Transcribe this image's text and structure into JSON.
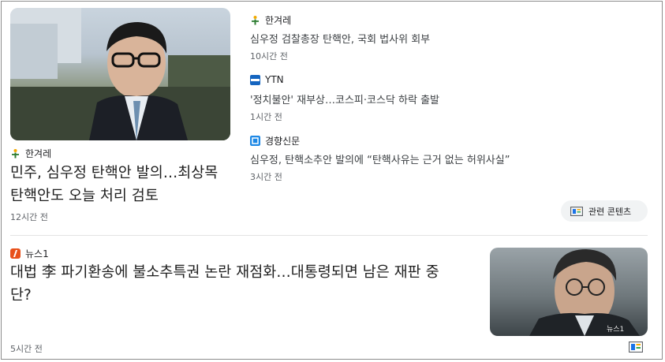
{
  "top_story": {
    "image_alt": "man with glasses in suit",
    "source": "한겨레",
    "headline_line1": "민주, 심우정 탄핵안 발의…최상목",
    "headline_line2": "탄핵안도 오늘 처리 검토",
    "time": "12시간 전"
  },
  "related_items": [
    {
      "source": "한겨레",
      "headline": "심우정 검찰총장 탄핵안, 국회 법사위 회부",
      "time": "10시간 전"
    },
    {
      "source": "YTN",
      "headline": "'정치불안' 재부상…코스피·코스닥 하락 출발",
      "time": "1시간 전"
    },
    {
      "source": "경향신문",
      "headline": "심우정, 탄핵소추안 발의에 “탄핵사유는 근거 없는 허위사실”",
      "time": "3시간 전"
    }
  ],
  "related_button": {
    "label": "관련 콘텐츠"
  },
  "second_story": {
    "source": "뉴스1",
    "headline_line1": "대법 李 파기환송에 불소추특권 논란 재점화…대통령되면 남은 재판 중",
    "headline_line2": "단?",
    "time": "5시간 전",
    "image_watermark": "뉴스1"
  },
  "colors": {
    "hani": "#2e7d32",
    "ytn": "#1565c0",
    "khan": "#1e88e5",
    "news1": "#e8501a",
    "icon_gray": "#5f6368"
  },
  "icons": [
    "hani-logo-icon",
    "ytn-logo-icon",
    "kyunghyang-logo-icon",
    "news1-logo-icon",
    "related-content-icon"
  ]
}
